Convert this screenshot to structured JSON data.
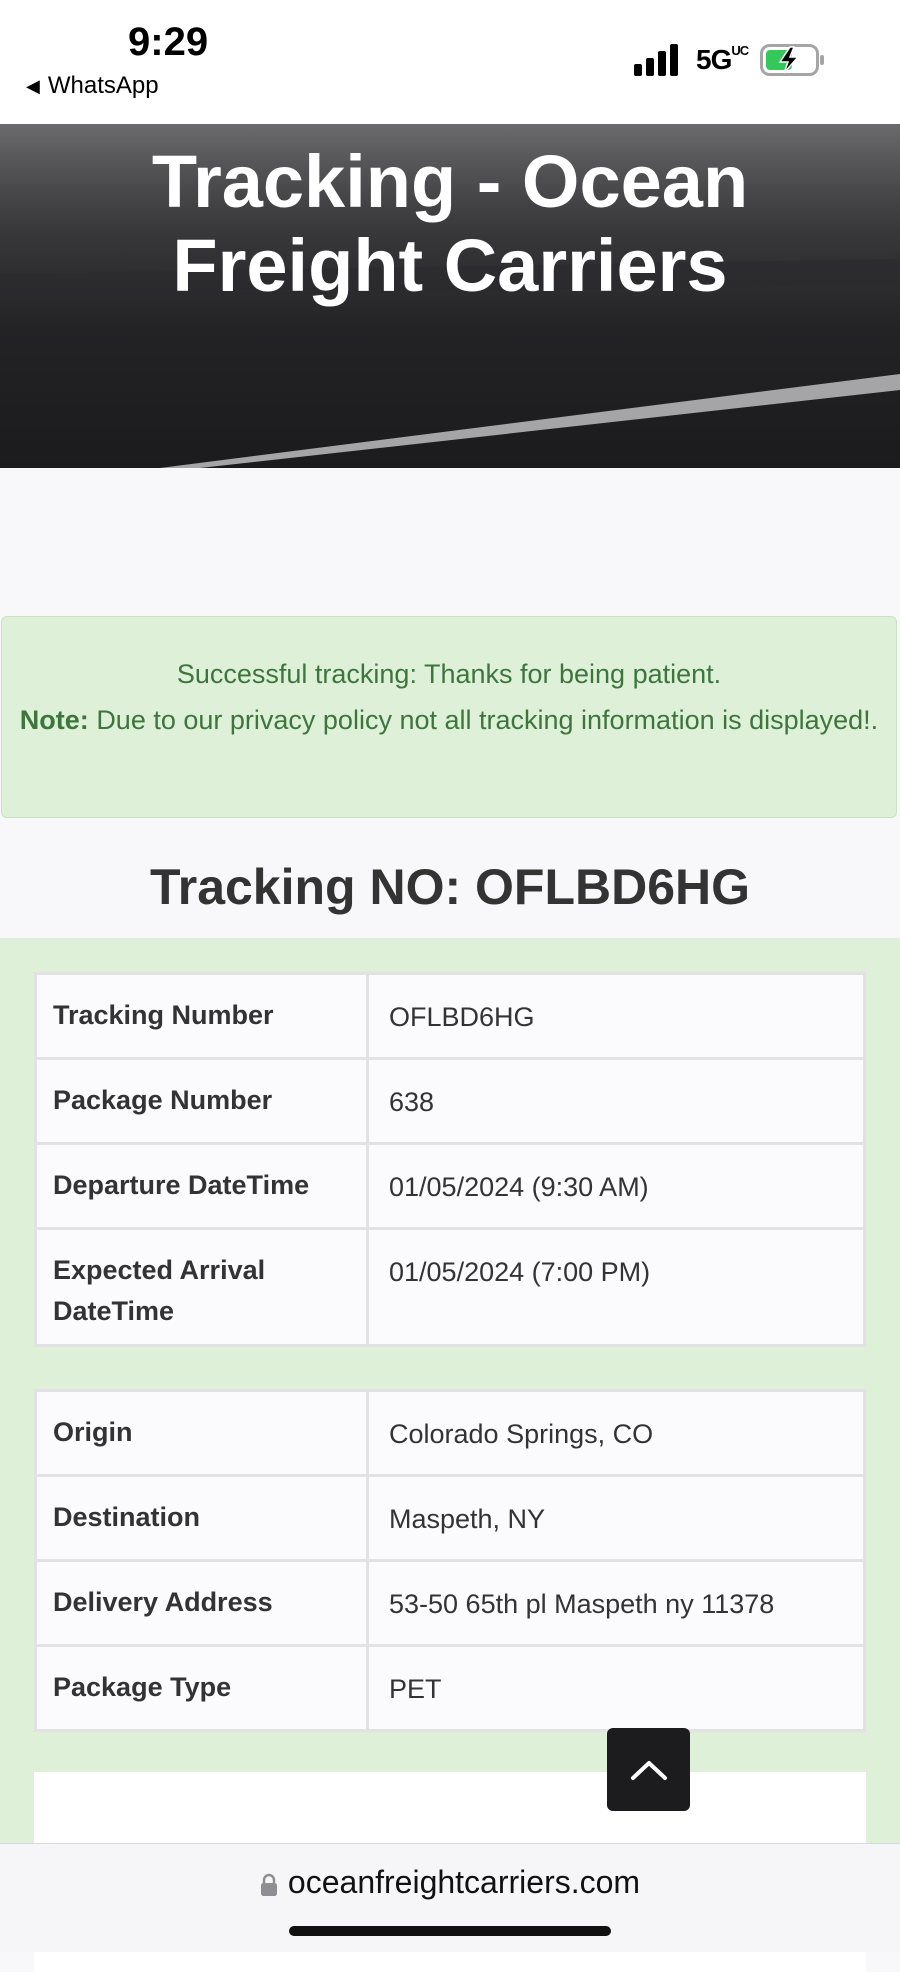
{
  "status_bar": {
    "time": "9:29",
    "back_app": "WhatsApp",
    "network": "5G",
    "network_sup": "UC"
  },
  "hero": {
    "title_line1": "Tracking - Ocean",
    "title_line2": "Freight Carriers"
  },
  "alert": {
    "line1": "Successful tracking: Thanks for being patient.",
    "note_label": "Note:",
    "note_text": "Due to our privacy policy not all tracking information is displayed!."
  },
  "tracking_heading": "Tracking NO: OFLBD6HG",
  "table1": [
    {
      "label": "Tracking Number",
      "value": "OFLBD6HG"
    },
    {
      "label": "Package Number",
      "value": "638"
    },
    {
      "label": "Departure DateTime",
      "value": "01/05/2024 (9:30 AM)"
    },
    {
      "label": "Expected Arrival DateTime",
      "value": "01/05/2024 (7:00 PM)"
    }
  ],
  "table2": [
    {
      "label": "Origin",
      "value": "Colorado Springs, CO"
    },
    {
      "label": "Destination",
      "value": "Maspeth, NY"
    },
    {
      "label": "Delivery Address",
      "value": "53-50 65th pl Maspeth ny 11378"
    },
    {
      "label": "Package Type",
      "value": "PET"
    }
  ],
  "url_bar": {
    "domain": "oceanfreightcarriers.com"
  },
  "colors": {
    "alert_bg": "#dff0d8",
    "alert_text": "#3c763d",
    "hero_bg": "#1b1b1e"
  },
  "icons": [
    "back-triangle-icon",
    "signal-icon",
    "battery-charging-icon",
    "chevron-up-icon",
    "lock-icon"
  ]
}
